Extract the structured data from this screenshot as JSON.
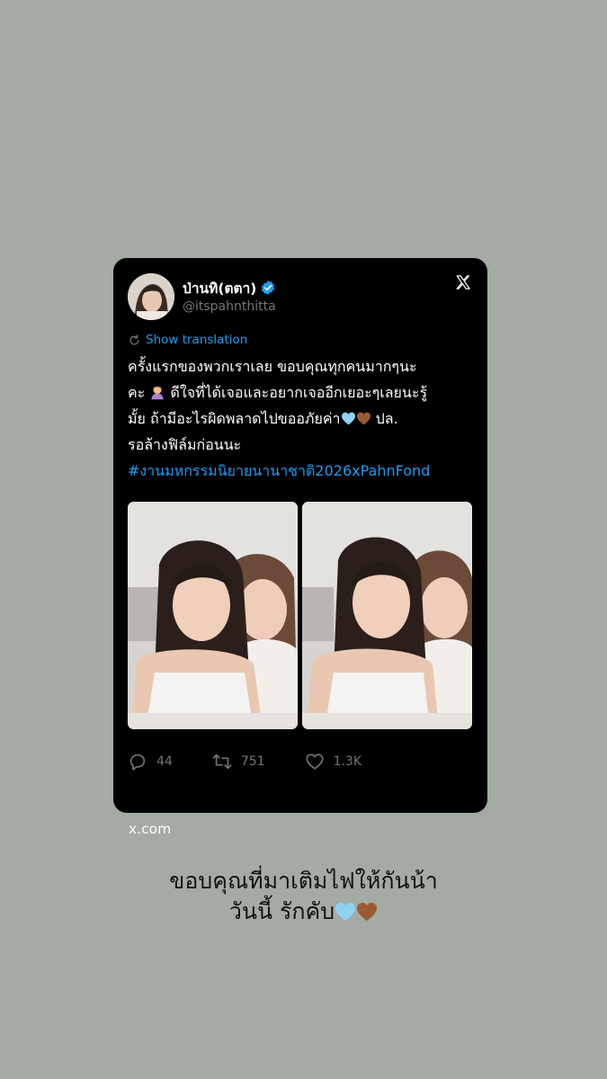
{
  "tweet": {
    "display_name": "ป่านทิ(ตตา)",
    "handle": "@itspahnthitta",
    "show_translation": "Show translation",
    "text_lines": [
      "ครั้งแรกของพวกเราเลย ขอบคุณทุกคนมากๆนะ",
      "คะ",
      "ดีใจที่ได้เจอและอยากเจออีกเยอะๆเลยนะรู้",
      "มั้ย ถ้ามีอะไรผิดพลาดไปขออภัยค่า",
      "ปล.",
      "รอล้างฟิล์มก่อนนะ"
    ],
    "hashtag": "#งานมหกรรมนิยายนานาชาติ2026xPahnFond",
    "replies": "44",
    "reposts": "751",
    "likes": "1.3K"
  },
  "source_domain": "x.com",
  "story_caption": {
    "line1": "ขอบคุณที่มาเติมไฟให้กันน้า",
    "line2": "วันนี้ รักคับ"
  },
  "colors": {
    "background": "#a3aba2",
    "card": "#000000",
    "link_blue": "#1d9bf0",
    "muted": "#71767b",
    "light_blue_heart": "#8fd3f4",
    "brown_heart": "#9a5b34"
  },
  "icons": [
    "verified-badge-icon",
    "x-logo-icon",
    "translate-icon",
    "reply-icon",
    "repost-icon",
    "like-icon"
  ]
}
